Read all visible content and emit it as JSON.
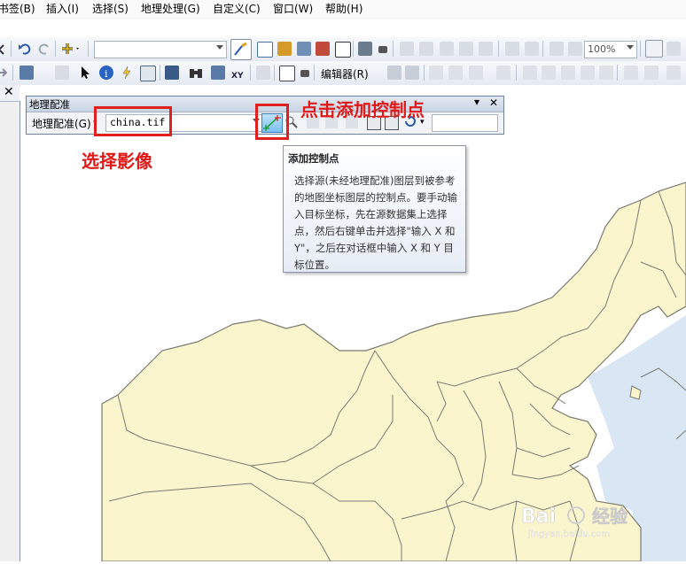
{
  "menu": [
    "书签(B)",
    "插入(I)",
    "选择(S)",
    "地理处理(G)",
    "自定义(C)",
    "窗口(W)",
    "帮助(H)"
  ],
  "toolbar1": {
    "zoom_value": "100%"
  },
  "toolbar2": {
    "editor_label": "编辑器(R)"
  },
  "left_panel": {
    "close_glyph": "✕"
  },
  "georef": {
    "title": "地理配准",
    "menu_label": "地理配准(G)",
    "layer_value": "china.tif",
    "pin_glyph": "▾",
    "close_glyph": "✕"
  },
  "annotations": {
    "select_image": "选择影像",
    "click_add": "点击添加控制点"
  },
  "tooltip": {
    "title": "添加控制点",
    "body": "选择源(未经地理配准)图层到被参考的地图坐标图层的控制点。要手动输入目标坐标，先在源数据集上选择点，然后右键单击并选择\"输入 X 和 Y\"，之后在对话框中输入 X 和 Y 目标位置。"
  },
  "colors": {
    "land": "#fbf4cc",
    "border": "#7a7a72",
    "water": "#d3e3f5",
    "annotation_red": "#e0201f"
  },
  "watermark": {
    "brand": "Bai",
    "brand2": "经验",
    "url": "jingyan.baidu.com"
  }
}
